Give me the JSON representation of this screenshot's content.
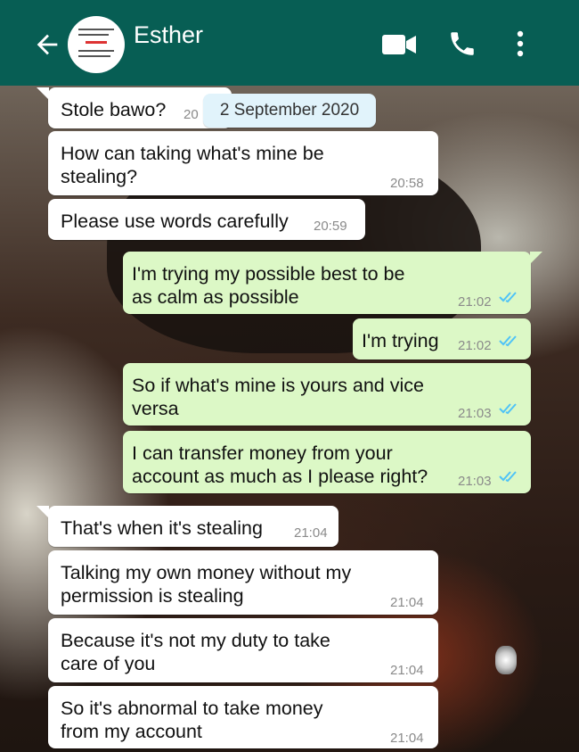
{
  "header": {
    "contact_name": "Esther",
    "background": "#075e54",
    "icons": [
      "back-arrow-icon",
      "video-call-icon",
      "phone-icon",
      "more-vert-icon"
    ]
  },
  "date_chip": "2 September 2020",
  "colors": {
    "incoming_bubble": "#ffffff",
    "outgoing_bubble": "#dcf8c6",
    "read_ticks": "#4fc3f7"
  },
  "messages": [
    {
      "direction": "in",
      "text": "Stole bawo?",
      "time": "20"
    },
    {
      "direction": "in",
      "line1": "How can taking what's mine be",
      "line2": "stealing?",
      "time": "20:58"
    },
    {
      "direction": "in",
      "text": "Please use words carefully",
      "time": "20:59"
    },
    {
      "direction": "out",
      "line1": "I'm trying my possible best to be",
      "line2": "as calm as possible",
      "time": "21:02",
      "status": "read"
    },
    {
      "direction": "out",
      "text": "I'm trying",
      "time": "21:02",
      "status": "read"
    },
    {
      "direction": "out",
      "line1": "So if what's mine is yours and vice",
      "line2": "versa",
      "time": "21:03",
      "status": "read"
    },
    {
      "direction": "out",
      "line1": "I can transfer money from your",
      "line2": "account as much as I please right?",
      "time": "21:03",
      "status": "read"
    },
    {
      "direction": "in",
      "text": "That's when it's stealing",
      "time": "21:04"
    },
    {
      "direction": "in",
      "line1": "Talking my own money without my",
      "line2": "permission is stealing",
      "time": "21:04"
    },
    {
      "direction": "in",
      "line1": "Because it's not my duty to take",
      "line2": "care of you",
      "time": "21:04"
    },
    {
      "direction": "in",
      "line1": "So it's abnormal to take money",
      "line2": "from my account",
      "time": "21:04"
    }
  ]
}
